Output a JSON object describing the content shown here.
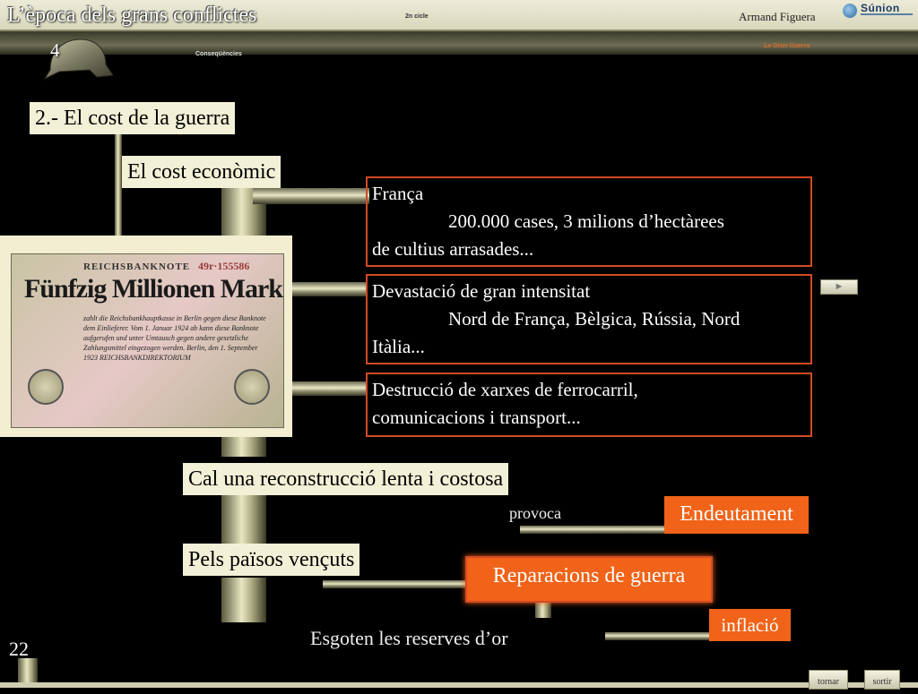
{
  "header": {
    "title": "L’època dels grans conflictes",
    "center_label": "2n cicle",
    "subtitle": "Conseqüències",
    "right_small": "La Gran Guerra",
    "author": "Armand Figuera",
    "logo_text": "Súnion",
    "unit_number": "4"
  },
  "section_title": "2.- El cost de la guerra",
  "economic_cost": "El cost econòmic",
  "items": [
    {
      "head": "França",
      "indent": "200.000 cases, 3 milions d’hectàrees",
      "tail": "de cultius arrasades..."
    },
    {
      "head": "Devastació de gran intensitat",
      "indent": "Nord de França, Bèlgica, Rússia, Nord",
      "tail": "Itàlia..."
    },
    {
      "head": "Destrucció de xarxes de ferrocarril,",
      "tail": "comunicacions i transport..."
    }
  ],
  "banknote": {
    "top": "REICHSBANKNOTE",
    "serial": "49r·155586",
    "big": "Fünfzig Millionen Mark",
    "body": "zahlt die Reichsbankhauptkasse in Berlin gegen diese Banknote dem Einlieferer. Vom 1. Januar 1924 ab kann diese Banknote aufgerufen und unter Umtausch gegen andere gesetzliche Zahlungsmittel eingezogen werden. Berlin, den 1. September 1923 REICHSBANKDIREKTORIUM"
  },
  "reconstruction": "Cal una reconstrucció lenta i costosa",
  "provoca": "provoca",
  "endeutament": "Endeutament",
  "vencuts": "Pels països vençuts",
  "reparacions": "Reparacions de guerra",
  "esgoten": "Esgoten les reserves d’or",
  "inflacio": "inflació",
  "nav": {
    "play": "►",
    "back": "tornar",
    "exit": "sortir"
  },
  "page_number": "22",
  "colors": {
    "accent_orange": "#f06318",
    "border_red": "#d24a26",
    "cream": "#f2f0d6"
  }
}
